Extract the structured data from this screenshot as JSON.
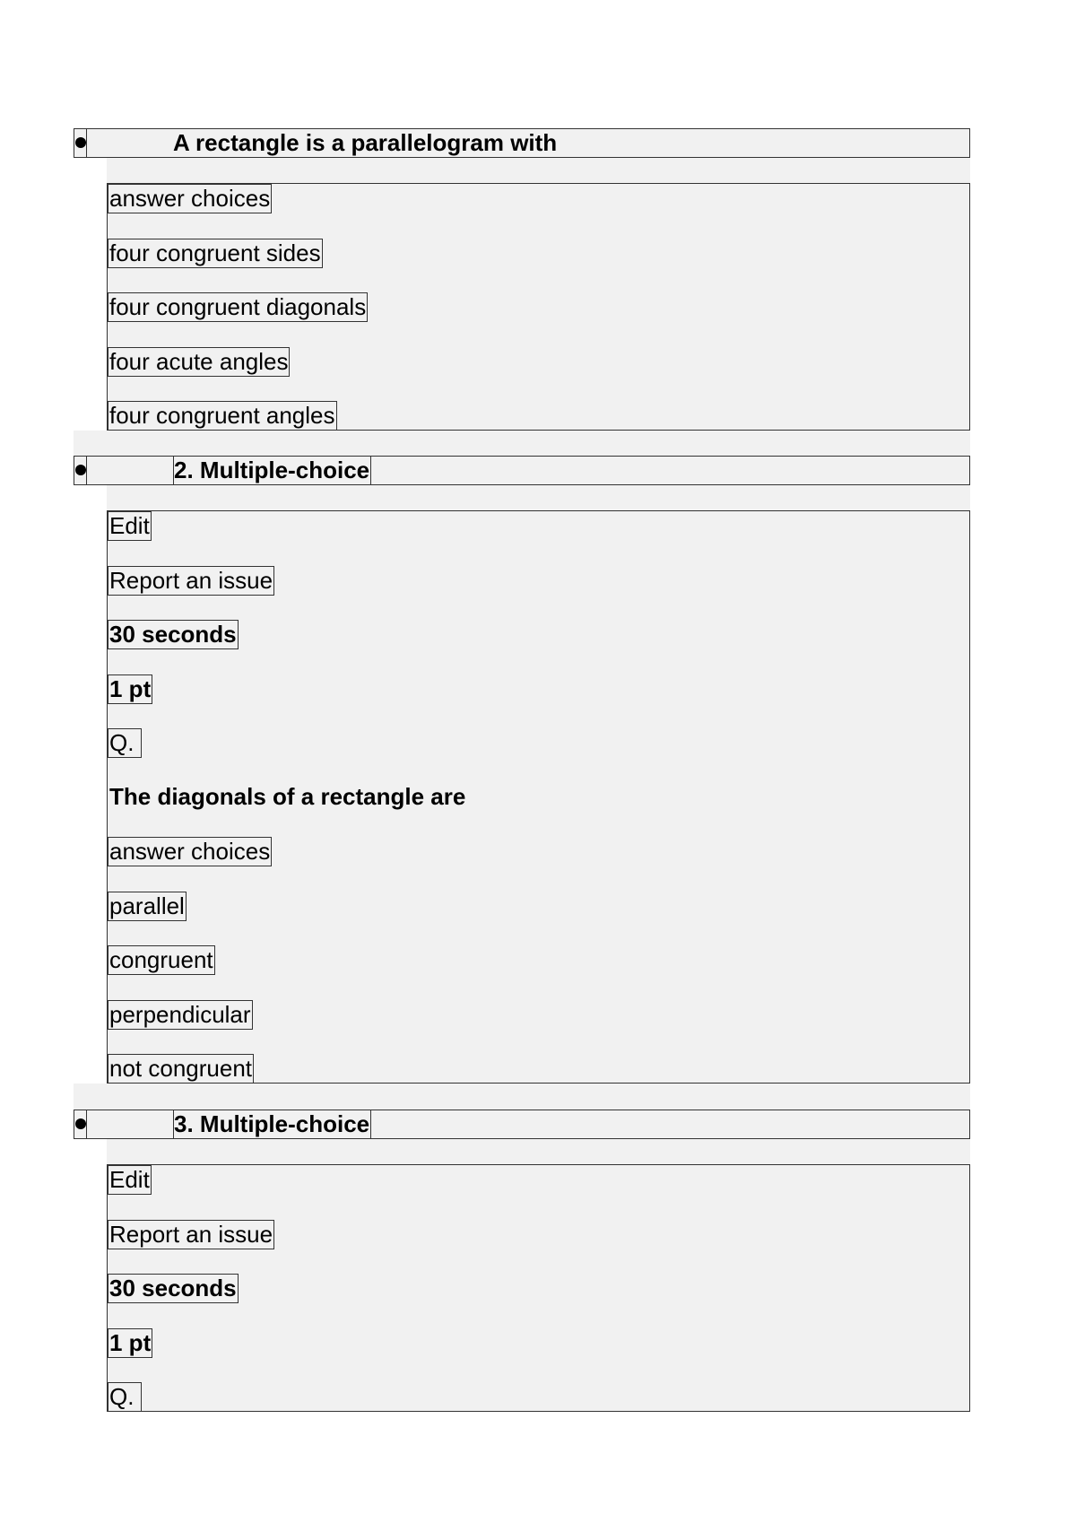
{
  "questions": [
    {
      "header": "A rectangle is a parallelogram with",
      "items": [
        {
          "text": "answer choices",
          "kind": "label"
        },
        {
          "text": "four congruent sides",
          "kind": "choice"
        },
        {
          "text": "four congruent diagonals",
          "kind": "choice"
        },
        {
          "text": "four acute angles",
          "kind": "choice"
        },
        {
          "text": "four congruent angles",
          "kind": "choice"
        }
      ]
    },
    {
      "header": "2. Multiple-choice",
      "edit_label": "Edit",
      "report_label": "Report an issue",
      "time": "30 seconds",
      "points": "1 pt",
      "q_label": "Q.",
      "question_text": "The diagonals of a rectangle are",
      "answer_choices_label": "answer choices",
      "choices": [
        "parallel",
        "congruent",
        "perpendicular",
        "not congruent"
      ]
    },
    {
      "header": "3. Multiple-choice",
      "edit_label": "Edit",
      "report_label": "Report an issue",
      "time": "30 seconds",
      "points": "1 pt",
      "q_label": "Q."
    }
  ]
}
